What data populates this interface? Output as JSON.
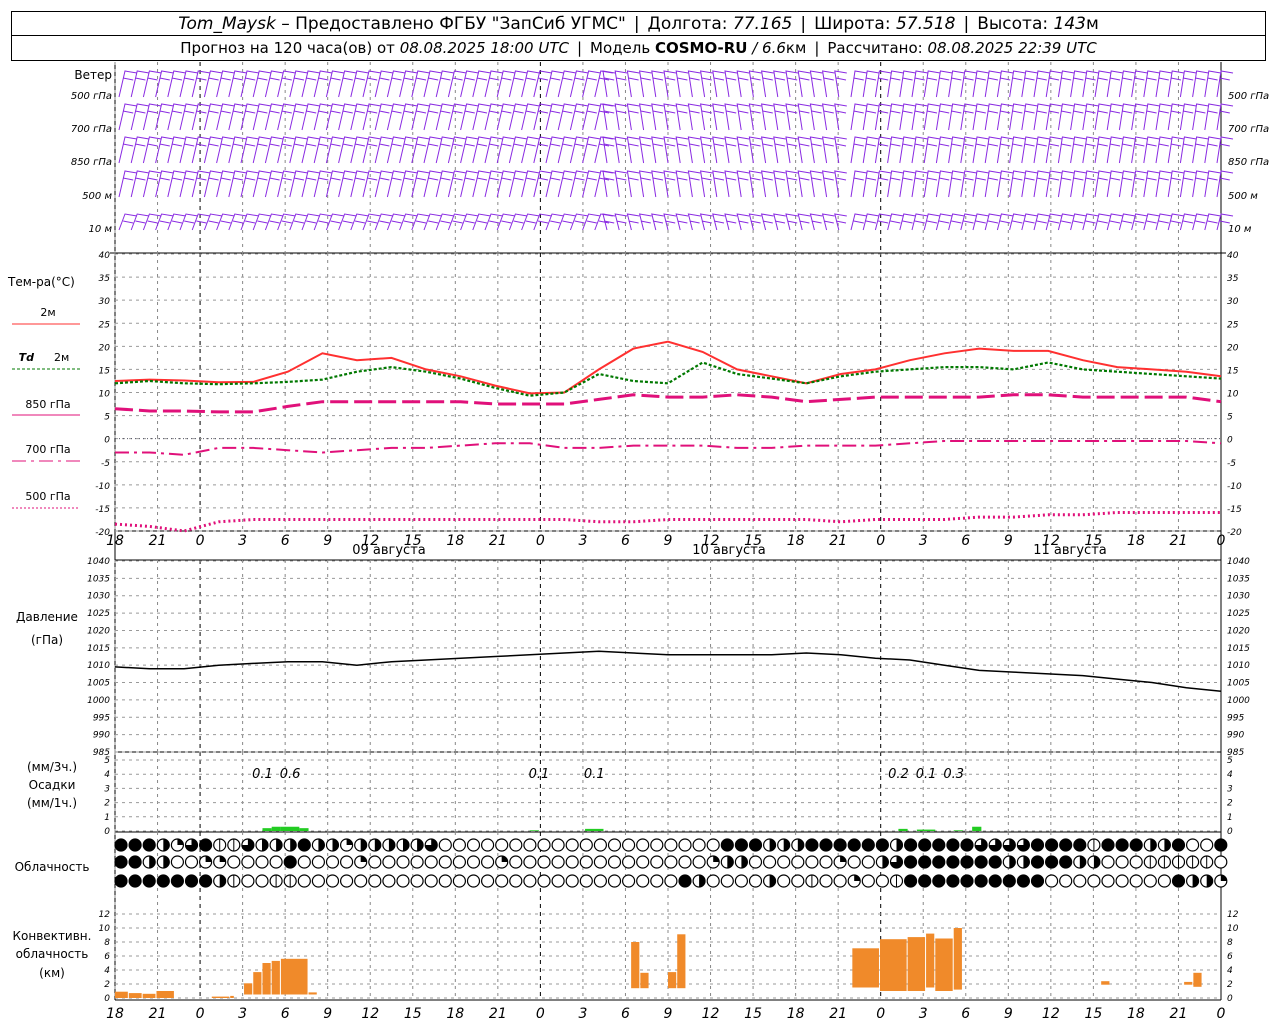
{
  "header": {
    "station": "Tom_Maysk",
    "provider": "– Предоставлено ФГБУ \"ЗапСиб УГМС\"",
    "lon_label": "Долгота:",
    "lon_value": "77.165",
    "lat_label": "Широта:",
    "lat_value": "57.518",
    "alt_label": "Высота:",
    "alt_value": "143",
    "alt_unit": "м",
    "forecast_text": "Прогноз на 120 часа(ов) от",
    "forecast_time": "08.08.2025 18:00 UTC",
    "model_label": "Модель",
    "model_name": "COSMO-RU",
    "model_res": "/ 6.6",
    "model_res_unit": "км",
    "calc_label": "Рассчитано:",
    "calc_time": "08.08.2025 22:39 UTC"
  },
  "colors": {
    "wind": "#8a2be2",
    "t2m": "#ff3030",
    "td2m": "#007800",
    "upper": "#e0107a",
    "pressure": "#000000",
    "precip": "#22cc22",
    "convective": "#f08a2a",
    "grid": "#999999"
  },
  "wind_panel": {
    "title": "Ветер",
    "levels": [
      "500 гПа",
      "700 гПа",
      "850 гПа",
      "500 м",
      "10 м"
    ]
  },
  "time_axis": {
    "ticks": [
      "18",
      "21",
      "0",
      "3",
      "6",
      "9",
      "12",
      "15",
      "18",
      "21",
      "0",
      "3",
      "6",
      "9",
      "12",
      "15",
      "18",
      "21",
      "0",
      "3",
      "6",
      "9",
      "12",
      "15",
      "18",
      "21",
      "0"
    ],
    "days": [
      "09 августа",
      "10 августа",
      "11 августа"
    ]
  },
  "chart_data": [
    {
      "type": "line",
      "title": "Тем-ра(°С)",
      "ylim": [
        -20,
        40
      ],
      "yticks": [
        "40",
        "35",
        "30",
        "25",
        "20",
        "15",
        "10",
        "5",
        "0",
        "-5",
        "-10",
        "-15",
        "-20"
      ],
      "series": [
        {
          "name": "2м",
          "values": [
            12.5,
            12.8,
            12.6,
            12.2,
            12.3,
            14.5,
            18.5,
            17.0,
            17.5,
            15.0,
            13.5,
            11.5,
            9.8,
            10.0,
            15.0,
            19.5,
            21.0,
            18.8,
            15.0,
            13.5,
            12.0,
            14.0,
            15.0,
            17.0,
            18.5,
            19.5,
            19.0,
            19.0,
            17.0,
            15.5,
            15.0,
            14.5,
            13.5
          ]
        },
        {
          "name": "Td 2м",
          "values": [
            12.0,
            12.5,
            12.0,
            11.8,
            12.0,
            12.3,
            12.8,
            14.5,
            15.5,
            14.5,
            13.0,
            11.0,
            9.3,
            10.0,
            14.0,
            12.5,
            12.0,
            16.5,
            14.0,
            13.0,
            12.0,
            13.5,
            14.5,
            15.0,
            15.5,
            15.5,
            15.0,
            16.5,
            15.0,
            14.5,
            14.0,
            13.5,
            13.0
          ]
        },
        {
          "name": "850 гПа",
          "values": [
            6.5,
            6.0,
            6.0,
            5.8,
            5.8,
            7.0,
            8.0,
            8.0,
            8.0,
            8.0,
            8.0,
            7.5,
            7.5,
            7.5,
            8.5,
            9.5,
            9.0,
            9.0,
            9.5,
            9.0,
            8.0,
            8.5,
            9.0,
            9.0,
            9.0,
            9.0,
            9.5,
            9.5,
            9.0,
            9.0,
            9.0,
            9.0,
            8.0
          ]
        },
        {
          "name": "700 гПа",
          "values": [
            -3.0,
            -3.0,
            -3.5,
            -2.0,
            -2.0,
            -2.5,
            -3.0,
            -2.5,
            -2.0,
            -2.0,
            -1.5,
            -1.0,
            -1.0,
            -2.0,
            -2.0,
            -1.5,
            -1.5,
            -1.5,
            -2.0,
            -2.0,
            -1.5,
            -1.5,
            -1.5,
            -1.0,
            -0.5,
            -0.5,
            -0.5,
            -0.5,
            -0.5,
            -0.5,
            -0.5,
            -0.5,
            -1.0
          ]
        },
        {
          "name": "500 гПа",
          "values": [
            -18.5,
            -19.0,
            -20.0,
            -18.0,
            -17.5,
            -17.5,
            -17.5,
            -17.5,
            -17.5,
            -17.5,
            -17.5,
            -17.5,
            -17.5,
            -17.5,
            -18.0,
            -18.0,
            -17.5,
            -17.5,
            -17.5,
            -17.5,
            -17.5,
            -18.0,
            -17.5,
            -17.5,
            -17.5,
            -17.0,
            -17.0,
            -16.5,
            -16.5,
            -16.0,
            -16.0,
            -16.0,
            -16.0
          ]
        }
      ]
    },
    {
      "type": "line",
      "title": "Давление",
      "unit": "(гПа)",
      "ylim": [
        985,
        1040
      ],
      "yticks": [
        "1040",
        "1035",
        "1030",
        "1025",
        "1020",
        "1015",
        "1010",
        "1005",
        "1000",
        "995",
        "990",
        "985"
      ],
      "series": [
        {
          "name": "",
          "values": [
            1009.5,
            1009,
            1009,
            1010,
            1010.5,
            1011,
            1011,
            1010,
            1011,
            1011.5,
            1012,
            1012.5,
            1013,
            1013.5,
            1014,
            1013.5,
            1013,
            1013,
            1013,
            1013,
            1013.5,
            1013,
            1012,
            1011.5,
            1010,
            1008.5,
            1008,
            1007.5,
            1007,
            1006,
            1005,
            1003.5,
            1002.5
          ]
        }
      ]
    },
    {
      "type": "bar",
      "title": "Осадки",
      "unit_top": "(мм/3ч.)",
      "unit_bottom": "(мм/1ч.)",
      "ylim": [
        0,
        5
      ],
      "yticks": [
        "5",
        "4",
        "3",
        "2",
        "1",
        "0"
      ],
      "labels": [
        {
          "x_hour": 34,
          "text": "0.1"
        },
        {
          "x_hour": 37,
          "text": "0.6"
        },
        {
          "x_hour": 64,
          "text": "0.1"
        },
        {
          "x_hour": 70,
          "text": "0.1"
        },
        {
          "x_hour": 103,
          "text": "0.2"
        },
        {
          "x_hour": 106,
          "text": "0.1"
        },
        {
          "x_hour": 109,
          "text": "0.3"
        }
      ],
      "bars": [
        {
          "from": 34,
          "to": 35,
          "value": 0.2
        },
        {
          "from": 35,
          "to": 36,
          "value": 0.3
        },
        {
          "from": 36,
          "to": 38,
          "value": 0.3
        },
        {
          "from": 38,
          "to": 39,
          "value": 0.2
        },
        {
          "from": 63,
          "to": 64,
          "value": 0.05
        },
        {
          "from": 69,
          "to": 71,
          "value": 0.15
        },
        {
          "from": 103,
          "to": 104,
          "value": 0.15
        },
        {
          "from": 105,
          "to": 107,
          "value": 0.1
        },
        {
          "from": 109,
          "to": 110,
          "value": 0.05
        },
        {
          "from": 111,
          "to": 112,
          "value": 0.3
        }
      ]
    },
    {
      "type": "bar",
      "title": "Конвективн. облачность",
      "unit": "(км)",
      "ylim": [
        0,
        14
      ],
      "yticks": [
        "12",
        "10",
        "8",
        "6",
        "4",
        "2",
        "0"
      ],
      "bars": [
        {
          "from": 18,
          "to": 19.5,
          "bottom": 0,
          "top": 0.9
        },
        {
          "from": 19.5,
          "to": 21,
          "bottom": 0,
          "top": 0.7
        },
        {
          "from": 21,
          "to": 22.5,
          "bottom": 0,
          "top": 0.6
        },
        {
          "from": 22.5,
          "to": 24.5,
          "bottom": 0,
          "top": 1.0
        },
        {
          "from": 28.5,
          "to": 30.5,
          "bottom": 0,
          "top": 0.2
        },
        {
          "from": 30.5,
          "to": 31,
          "bottom": 0,
          "top": 0.3
        },
        {
          "from": 32,
          "to": 33,
          "bottom": 0.5,
          "top": 2.1
        },
        {
          "from": 33,
          "to": 34,
          "bottom": 0.5,
          "top": 3.7
        },
        {
          "from": 34,
          "to": 35,
          "bottom": 0.5,
          "top": 5.0
        },
        {
          "from": 35,
          "to": 36,
          "bottom": 0.5,
          "top": 5.3
        },
        {
          "from": 36,
          "to": 39,
          "bottom": 0.5,
          "top": 5.6
        },
        {
          "from": 39,
          "to": 40,
          "bottom": 0.5,
          "top": 0.8
        },
        {
          "from": 74,
          "to": 75,
          "bottom": 1.4,
          "top": 8.0
        },
        {
          "from": 75,
          "to": 76,
          "bottom": 1.4,
          "top": 3.6
        },
        {
          "from": 78,
          "to": 79,
          "bottom": 1.4,
          "top": 3.7
        },
        {
          "from": 79,
          "to": 80,
          "bottom": 1.4,
          "top": 9.1
        },
        {
          "from": 98,
          "to": 101,
          "bottom": 1.5,
          "top": 7.1
        },
        {
          "from": 101,
          "to": 104,
          "bottom": 1.0,
          "top": 8.4
        },
        {
          "from": 104,
          "to": 106,
          "bottom": 1.0,
          "top": 8.7
        },
        {
          "from": 106,
          "to": 107,
          "bottom": 1.5,
          "top": 9.2
        },
        {
          "from": 107,
          "to": 109,
          "bottom": 1.0,
          "top": 8.5
        },
        {
          "from": 109,
          "to": 110,
          "bottom": 1.2,
          "top": 10.0
        },
        {
          "from": 125,
          "to": 126,
          "bottom": 1.9,
          "top": 2.4
        },
        {
          "from": 134,
          "to": 135,
          "bottom": 1.9,
          "top": 2.3
        },
        {
          "from": 135,
          "to": 136,
          "bottom": 1.6,
          "top": 3.6
        }
      ]
    }
  ],
  "legend": {
    "t2m": "2м",
    "td_label": "Td",
    "td_suffix": "2м",
    "l850": "850 гПа",
    "l700": "700 гПа",
    "l500": "500 гПа"
  },
  "cloud_panel": {
    "title": "Облачность",
    "rows": [
      "FFFHQTFSSTHHHFHHQHHHHHTOOOOOOOOOOOOOOOOOOOOFFFHHHFFFFFFHFFFFFTTTTFFFFSFFFHHFOOF",
      "FFHHOOQQOOOOFOOOOQOOOOOOOOOQOOOOOOOOOOOOOOQHHOOOOOOQOOHTFFFFFFFHHFFFHHOOOSSSSSOO",
      "FFFFFFFHSOOSSOOOOOOOOOOOOOOOOOOOOOOOOOOOFHOOOOHOOSOOQOOSFFFFFFFFFFOOOOOOOOOFHHQQH"
    ]
  }
}
